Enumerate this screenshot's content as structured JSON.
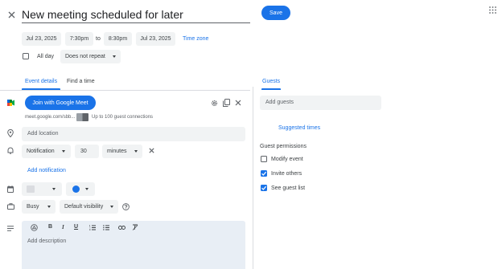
{
  "header": {
    "title": "New meeting scheduled for later",
    "save_label": "Save"
  },
  "datetime": {
    "start_date": "Jul 23, 2025",
    "start_time": "7:30pm",
    "to_label": "to",
    "end_time": "8:30pm",
    "end_date": "Jul 23, 2025",
    "timezone_label": "Time zone"
  },
  "allday": {
    "label": "All day",
    "checked": false,
    "repeat_value": "Does not repeat"
  },
  "tabs": [
    {
      "label": "Event details",
      "active": true
    },
    {
      "label": "Find a time",
      "active": false
    }
  ],
  "meet": {
    "join_label": "Join with Google Meet",
    "link_text": "meet.google.com/sbb...",
    "capacity_text": "Up to 100 guest connections"
  },
  "location": {
    "placeholder": "Add location"
  },
  "notification": {
    "type": "Notification",
    "amount": "30",
    "unit": "minutes",
    "add_label": "Add notification"
  },
  "calendar_color": {
    "color": "#1a73e8"
  },
  "availability": {
    "status": "Busy",
    "visibility": "Default visibility"
  },
  "description": {
    "placeholder": "Add description"
  },
  "guests": {
    "heading": "Guests",
    "add_placeholder": "Add guests",
    "suggested_label": "Suggested times",
    "permissions_heading": "Guest permissions",
    "permissions": [
      {
        "label": "Modify event",
        "checked": false
      },
      {
        "label": "Invite others",
        "checked": true
      },
      {
        "label": "See guest list",
        "checked": true
      }
    ]
  },
  "colors": {
    "accent": "#1a73e8",
    "chip_bg": "#f1f3f4",
    "description_bg": "#e8eef5"
  }
}
